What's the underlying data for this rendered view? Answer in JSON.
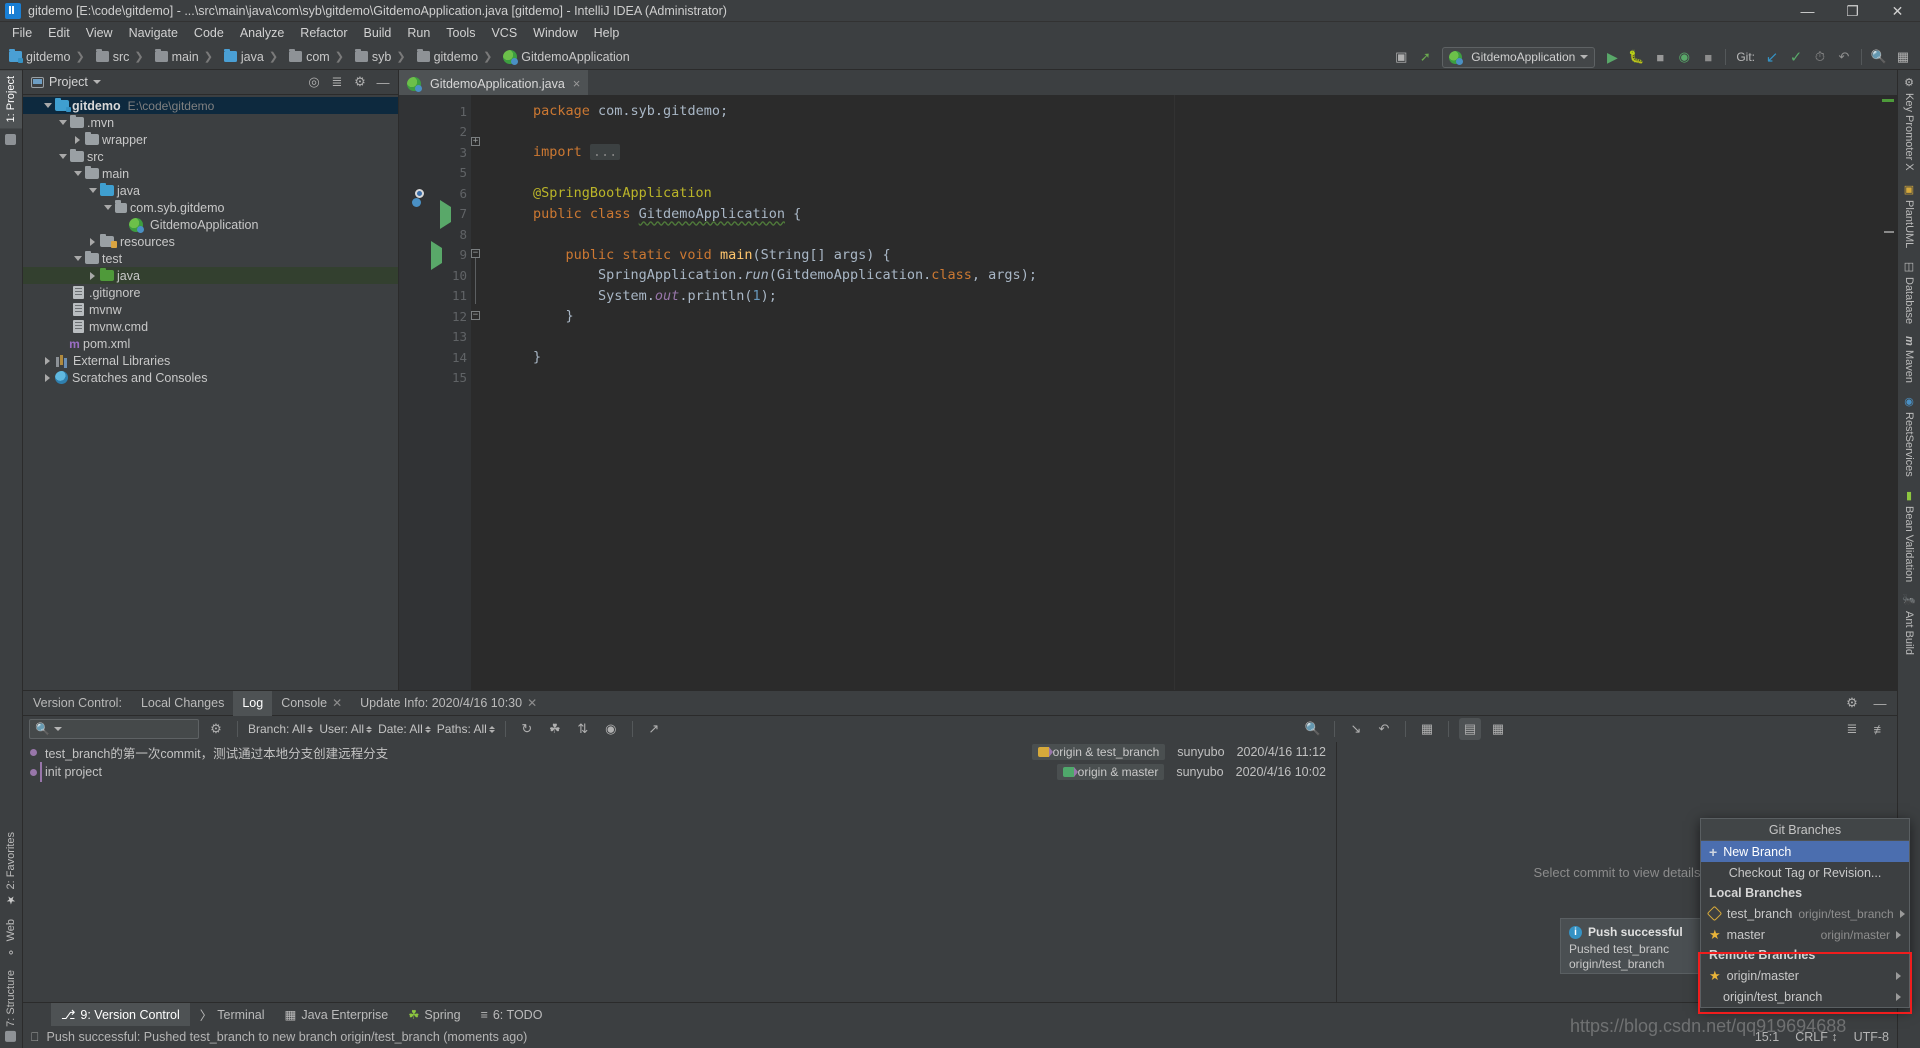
{
  "window": {
    "title": "gitdemo [E:\\code\\gitdemo] - ...\\src\\main\\java\\com\\syb\\gitdemo\\GitdemoApplication.java [gitdemo] - IntelliJ IDEA (Administrator)",
    "minimize": "—",
    "maximize": "❐",
    "close": "✕"
  },
  "menu": [
    "File",
    "Edit",
    "View",
    "Navigate",
    "Code",
    "Analyze",
    "Refactor",
    "Build",
    "Run",
    "Tools",
    "VCS",
    "Window",
    "Help"
  ],
  "breadcrumb": [
    {
      "label": "gitdemo",
      "icon": "folder-module-icon"
    },
    {
      "label": "src",
      "icon": "folder-icon"
    },
    {
      "label": "main",
      "icon": "folder-icon"
    },
    {
      "label": "java",
      "icon": "folder-source-icon"
    },
    {
      "label": "com",
      "icon": "folder-icon"
    },
    {
      "label": "syb",
      "icon": "folder-icon"
    },
    {
      "label": "gitdemo",
      "icon": "folder-icon"
    },
    {
      "label": "GitdemoApplication",
      "icon": "spring-class-icon"
    }
  ],
  "toolbar": {
    "run_config": "GitdemoApplication",
    "git_label": "Git:",
    "buttons": [
      "project-structure-icon",
      "build-icon",
      "run-icon",
      "debug-icon",
      "run-with-coverage-icon",
      "profile-icon",
      "stop-icon",
      "update-project-icon",
      "commit-icon",
      "history-icon",
      "rollback-icon",
      "search-everywhere-icon",
      "project-settings-icon"
    ]
  },
  "left_rail": {
    "top": [
      {
        "label": "1: Project",
        "active": true
      },
      {
        "label": "",
        "icon": "folder-icon",
        "active": false
      }
    ],
    "bottom": [
      {
        "label": "2: Favorites",
        "icon": "star-icon"
      },
      {
        "label": "Web",
        "icon": "web-icon"
      },
      {
        "label": "7: Structure",
        "icon": "structure-icon"
      }
    ]
  },
  "right_rail": [
    {
      "label": "Key Promoter X",
      "icon": "key-promoter-icon"
    },
    {
      "label": "PlantUML",
      "icon": "plantuml-icon"
    },
    {
      "label": "Database",
      "icon": "database-icon"
    },
    {
      "label": "Maven",
      "icon": "maven-icon"
    },
    {
      "label": "RestServices",
      "icon": "rest-services-icon"
    },
    {
      "label": "Bean Validation",
      "icon": "bean-validation-icon"
    },
    {
      "label": "Ant Build",
      "icon": "ant-build-icon"
    }
  ],
  "project_panel": {
    "title": "Project",
    "actions": [
      "locate-icon",
      "collapse-all-icon",
      "settings-icon",
      "hide-icon"
    ],
    "tree": [
      {
        "label": "gitdemo",
        "path": "E:\\code\\gitdemo",
        "depth": 0,
        "arrow": "down",
        "icon": "module-icon",
        "selected": true,
        "bold": true
      },
      {
        "label": ".mvn",
        "path": "",
        "depth": 1,
        "arrow": "down",
        "icon": "folder-icon"
      },
      {
        "label": "wrapper",
        "path": "",
        "depth": 2,
        "arrow": "right",
        "icon": "folder-icon"
      },
      {
        "label": "src",
        "path": "",
        "depth": 1,
        "arrow": "down",
        "icon": "folder-icon"
      },
      {
        "label": "main",
        "path": "",
        "depth": 2,
        "arrow": "down",
        "icon": "folder-icon"
      },
      {
        "label": "java",
        "path": "",
        "depth": 3,
        "arrow": "down",
        "icon": "folder-source-icon"
      },
      {
        "label": "com.syb.gitdemo",
        "path": "",
        "depth": 4,
        "arrow": "down",
        "icon": "package-icon"
      },
      {
        "label": "GitdemoApplication",
        "path": "",
        "depth": 5,
        "arrow": "none",
        "icon": "spring-class-icon"
      },
      {
        "label": "resources",
        "path": "",
        "depth": 3,
        "arrow": "right",
        "icon": "folder-resources-icon"
      },
      {
        "label": "test",
        "path": "",
        "depth": 2,
        "arrow": "down",
        "icon": "folder-icon"
      },
      {
        "label": "java",
        "path": "",
        "depth": 3,
        "arrow": "right",
        "icon": "folder-test-source-icon",
        "selected_green": true
      },
      {
        "label": ".gitignore",
        "path": "",
        "depth": 1,
        "arrow": "none",
        "icon": "file-icon"
      },
      {
        "label": "mvnw",
        "path": "",
        "depth": 1,
        "arrow": "none",
        "icon": "file-icon"
      },
      {
        "label": "mvnw.cmd",
        "path": "",
        "depth": 1,
        "arrow": "none",
        "icon": "file-icon"
      },
      {
        "label": "pom.xml",
        "path": "",
        "depth": 1,
        "arrow": "none",
        "icon": "maven-file-icon"
      },
      {
        "label": "External Libraries",
        "path": "",
        "depth": 0,
        "arrow": "right",
        "icon": "libraries-icon"
      },
      {
        "label": "Scratches and Consoles",
        "path": "",
        "depth": 0,
        "arrow": "right",
        "icon": "scratches-icon"
      }
    ]
  },
  "editor": {
    "tab": "GitdemoApplication.java",
    "tab_close": "×",
    "line_numbers": [
      "1",
      "2",
      "3",
      "5",
      "6",
      "7",
      "8",
      "9",
      "10",
      "11",
      "12",
      "13",
      "14",
      "15"
    ],
    "lines": [
      "package com.syb.gitdemo;",
      "",
      "import ...",
      "",
      "@SpringBootApplication",
      "public class GitdemoApplication {",
      "",
      "    public static void main(String[] args) {",
      "        SpringApplication.run(GitdemoApplication.class, args);",
      "        System.out.println(1);",
      "    }",
      "",
      "}",
      ""
    ],
    "import_fold": "..."
  },
  "vcs": {
    "label": "Version Control:",
    "tabs": [
      {
        "label": "Local Changes",
        "closable": false,
        "active": false
      },
      {
        "label": "Log",
        "closable": false,
        "active": true
      },
      {
        "label": "Console",
        "closable": true,
        "active": false
      },
      {
        "label": "Update Info: 2020/4/16 10:30",
        "closable": true,
        "active": false
      }
    ],
    "search_placeholder": "",
    "filters": [
      "Branch: All",
      "User: All",
      "Date: All",
      "Paths: All"
    ],
    "toolbar_icons": [
      "refresh-icon",
      "cherry-pick-icon",
      "sort-icon",
      "show-details-icon",
      "open-in-editor-icon",
      "search-icon",
      "go-to-child-icon",
      "revert-icon",
      "intellisort-icon",
      "bottom-layout-icon",
      "side-layout-icon",
      "settings-icon",
      "hide-icon",
      "expand-icon",
      "collapse-icon"
    ],
    "commits": [
      {
        "subject": "test_branch的第一次commit，测试通过本地分支创建远程分支",
        "refs": "origin & test_branch",
        "author": "sunyubo",
        "date": "2020/4/16 11:12"
      },
      {
        "subject": "init project",
        "refs": "origin & master",
        "author": "sunyubo",
        "date": "2020/4/16 10:02"
      }
    ],
    "details_placeholder": "Select commit to view details"
  },
  "notification": {
    "title": "Push successful",
    "line1": "Pushed test_branc",
    "line2": "origin/test_branch"
  },
  "git_branches_popup": {
    "title": "Git Branches",
    "new_branch": "New Branch",
    "checkout": "Checkout Tag or Revision...",
    "local_header": "Local Branches",
    "local": [
      {
        "name": "test_branch",
        "tracking": "origin/test_branch",
        "icon": "branch-tag-icon"
      },
      {
        "name": "master",
        "tracking": "origin/master",
        "icon": "star-icon"
      }
    ],
    "remote_header": "Remote Branches",
    "remote": [
      {
        "name": "origin/master",
        "icon": "star-icon"
      },
      {
        "name": "origin/test_branch",
        "icon": "none"
      }
    ]
  },
  "bottom_tabs": [
    {
      "label": "9: Version Control",
      "icon": "vcs-icon",
      "active": true
    },
    {
      "label": "Terminal",
      "icon": "terminal-icon",
      "active": false
    },
    {
      "label": "Java Enterprise",
      "icon": "java-ee-icon",
      "active": false
    },
    {
      "label": "Spring",
      "icon": "spring-icon",
      "active": false
    },
    {
      "label": "6: TODO",
      "icon": "todo-icon",
      "active": false
    }
  ],
  "status_bar": {
    "message": "Push successful: Pushed test_branch to new branch origin/test_branch (moments ago)",
    "caret": "15:1",
    "line_sep": "CRLF",
    "encoding": "UTF-8"
  },
  "watermark": "https://blog.csdn.net/qq919694688",
  "colors": {
    "accent_blue": "#4b6eaf",
    "panel_bg": "#3c3f41",
    "editor_bg": "#2b2b2b",
    "highlight_red": "#f01d1d",
    "keyword_orange": "#cc7832",
    "annotation_yellow": "#bbb529"
  }
}
